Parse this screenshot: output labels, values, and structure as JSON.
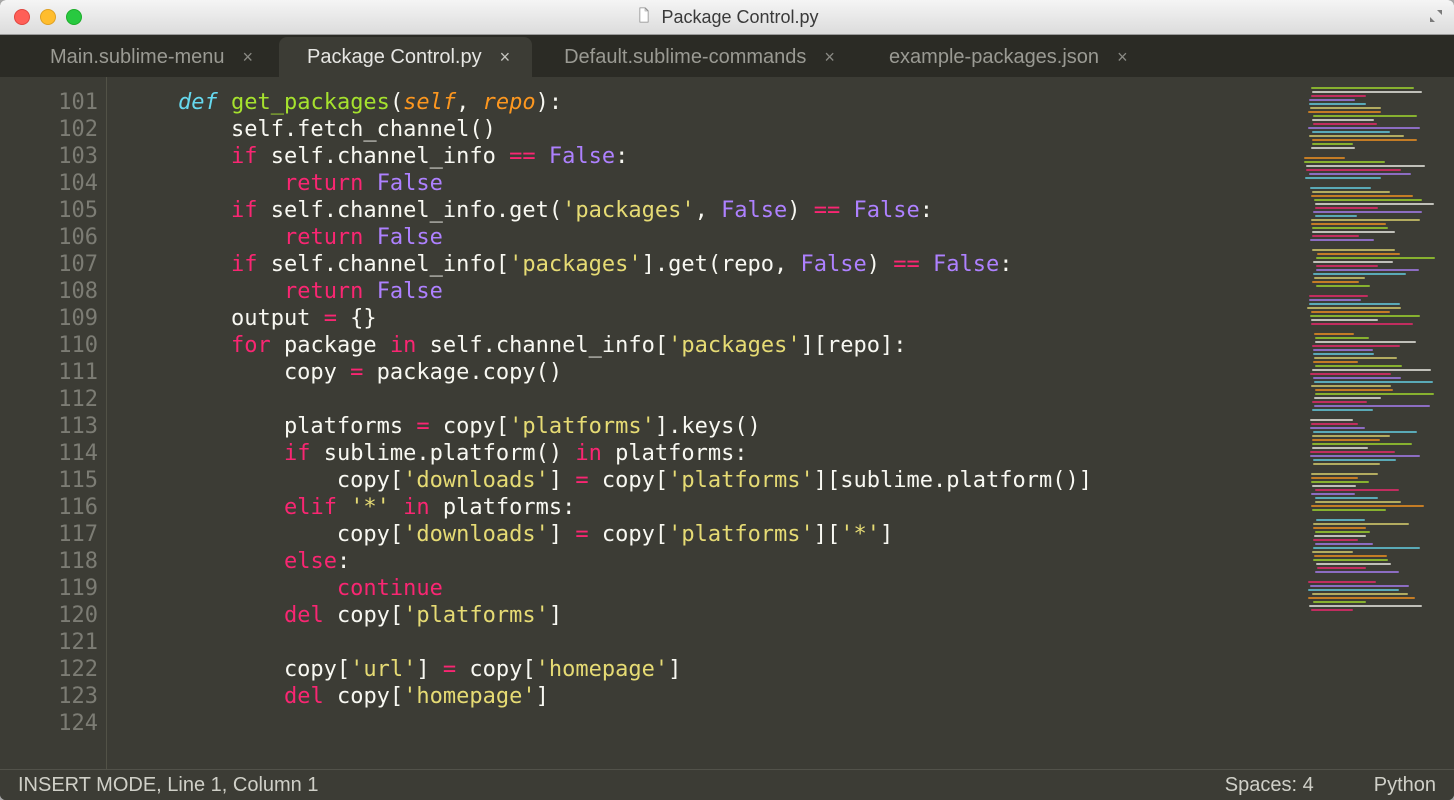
{
  "window": {
    "title": "Package Control.py"
  },
  "tabs": [
    {
      "label": "Main.sublime-menu",
      "active": false
    },
    {
      "label": "Package Control.py",
      "active": true
    },
    {
      "label": "Default.sublime-commands",
      "active": false
    },
    {
      "label": "example-packages.json",
      "active": false
    }
  ],
  "close_glyph": "×",
  "gutter": {
    "start": 101,
    "end": 124
  },
  "code_lines": [
    [
      [
        "    ",
        ""
      ],
      [
        "def",
        "kw"
      ],
      [
        " ",
        ""
      ],
      [
        "get_packages",
        "fn"
      ],
      [
        "(",
        ""
      ],
      [
        "self",
        "prm"
      ],
      [
        ", ",
        ""
      ],
      [
        "repo",
        "prm"
      ],
      [
        "):",
        ""
      ]
    ],
    [
      [
        "        self.fetch_channel()",
        ""
      ]
    ],
    [
      [
        "        ",
        ""
      ],
      [
        "if",
        "kw2"
      ],
      [
        " self.channel_info ",
        ""
      ],
      [
        "==",
        "op"
      ],
      [
        " ",
        ""
      ],
      [
        "False",
        "cst"
      ],
      [
        ":",
        ""
      ]
    ],
    [
      [
        "            ",
        ""
      ],
      [
        "return",
        "kw2"
      ],
      [
        " ",
        ""
      ],
      [
        "False",
        "cst"
      ]
    ],
    [
      [
        "        ",
        ""
      ],
      [
        "if",
        "kw2"
      ],
      [
        " self.channel_info.get(",
        ""
      ],
      [
        "'packages'",
        "str"
      ],
      [
        ", ",
        ""
      ],
      [
        "False",
        "cst"
      ],
      [
        ") ",
        ""
      ],
      [
        "==",
        "op"
      ],
      [
        " ",
        ""
      ],
      [
        "False",
        "cst"
      ],
      [
        ":",
        ""
      ]
    ],
    [
      [
        "            ",
        ""
      ],
      [
        "return",
        "kw2"
      ],
      [
        " ",
        ""
      ],
      [
        "False",
        "cst"
      ]
    ],
    [
      [
        "        ",
        ""
      ],
      [
        "if",
        "kw2"
      ],
      [
        " self.channel_info[",
        ""
      ],
      [
        "'packages'",
        "str"
      ],
      [
        "].get(repo, ",
        ""
      ],
      [
        "False",
        "cst"
      ],
      [
        ") ",
        ""
      ],
      [
        "==",
        "op"
      ],
      [
        " ",
        ""
      ],
      [
        "False",
        "cst"
      ],
      [
        ":",
        ""
      ]
    ],
    [
      [
        "            ",
        ""
      ],
      [
        "return",
        "kw2"
      ],
      [
        " ",
        ""
      ],
      [
        "False",
        "cst"
      ]
    ],
    [
      [
        "        output ",
        ""
      ],
      [
        "=",
        "op"
      ],
      [
        " {}",
        ""
      ]
    ],
    [
      [
        "        ",
        ""
      ],
      [
        "for",
        "kw2"
      ],
      [
        " package ",
        ""
      ],
      [
        "in",
        "op"
      ],
      [
        " self.channel_info[",
        ""
      ],
      [
        "'packages'",
        "str"
      ],
      [
        "][repo]:",
        ""
      ]
    ],
    [
      [
        "            copy ",
        ""
      ],
      [
        "=",
        "op"
      ],
      [
        " package.copy()",
        ""
      ]
    ],
    [
      [
        "",
        ""
      ]
    ],
    [
      [
        "            platforms ",
        ""
      ],
      [
        "=",
        "op"
      ],
      [
        " copy[",
        ""
      ],
      [
        "'platforms'",
        "str"
      ],
      [
        "].keys()",
        ""
      ]
    ],
    [
      [
        "            ",
        ""
      ],
      [
        "if",
        "kw2"
      ],
      [
        " sublime.platform() ",
        ""
      ],
      [
        "in",
        "op"
      ],
      [
        " platforms:",
        ""
      ]
    ],
    [
      [
        "                copy[",
        ""
      ],
      [
        "'downloads'",
        "str"
      ],
      [
        "] ",
        ""
      ],
      [
        "=",
        "op"
      ],
      [
        " copy[",
        ""
      ],
      [
        "'platforms'",
        "str"
      ],
      [
        "][sublime.platform()]",
        ""
      ]
    ],
    [
      [
        "            ",
        ""
      ],
      [
        "elif",
        "kw2"
      ],
      [
        " ",
        ""
      ],
      [
        "'*'",
        "str"
      ],
      [
        " ",
        ""
      ],
      [
        "in",
        "op"
      ],
      [
        " platforms:",
        ""
      ]
    ],
    [
      [
        "                copy[",
        ""
      ],
      [
        "'downloads'",
        "str"
      ],
      [
        "] ",
        ""
      ],
      [
        "=",
        "op"
      ],
      [
        " copy[",
        ""
      ],
      [
        "'platforms'",
        "str"
      ],
      [
        "][",
        ""
      ],
      [
        "'*'",
        "str"
      ],
      [
        "]",
        ""
      ]
    ],
    [
      [
        "            ",
        ""
      ],
      [
        "else",
        "kw2"
      ],
      [
        ":",
        ""
      ]
    ],
    [
      [
        "                ",
        ""
      ],
      [
        "continue",
        "kw2"
      ]
    ],
    [
      [
        "            ",
        ""
      ],
      [
        "del",
        "kw2"
      ],
      [
        " copy[",
        ""
      ],
      [
        "'platforms'",
        "str"
      ],
      [
        "]",
        ""
      ]
    ],
    [
      [
        "",
        ""
      ]
    ],
    [
      [
        "            copy[",
        ""
      ],
      [
        "'url'",
        "str"
      ],
      [
        "] ",
        ""
      ],
      [
        "=",
        "op"
      ],
      [
        " copy[",
        ""
      ],
      [
        "'homepage'",
        "str"
      ],
      [
        "]",
        ""
      ]
    ],
    [
      [
        "            ",
        ""
      ],
      [
        "del",
        "kw2"
      ],
      [
        " copy[",
        ""
      ],
      [
        "'homepage'",
        "str"
      ],
      [
        "]",
        ""
      ]
    ],
    [
      [
        "",
        ""
      ]
    ]
  ],
  "status": {
    "left": "INSERT MODE, Line 1, Column 1",
    "spaces": "Spaces: 4",
    "lang": "Python"
  },
  "minimap_blocks": [
    {
      "lines": 16,
      "indent": 8
    },
    {
      "lines": 6,
      "indent": 4
    },
    {
      "lines": 14,
      "indent": 10
    },
    {
      "lines": 10,
      "indent": 12
    },
    {
      "lines": 8,
      "indent": 6
    },
    {
      "lines": 20,
      "indent": 10
    },
    {
      "lines": 12,
      "indent": 8
    },
    {
      "lines": 10,
      "indent": 10
    },
    {
      "lines": 14,
      "indent": 12
    },
    {
      "lines": 8,
      "indent": 8
    }
  ],
  "minimap_colors": [
    "#66d9ef",
    "#f92672",
    "#a6e22e",
    "#e6db74",
    "#ae81ff",
    "#f8f8f2",
    "#fd971f"
  ]
}
